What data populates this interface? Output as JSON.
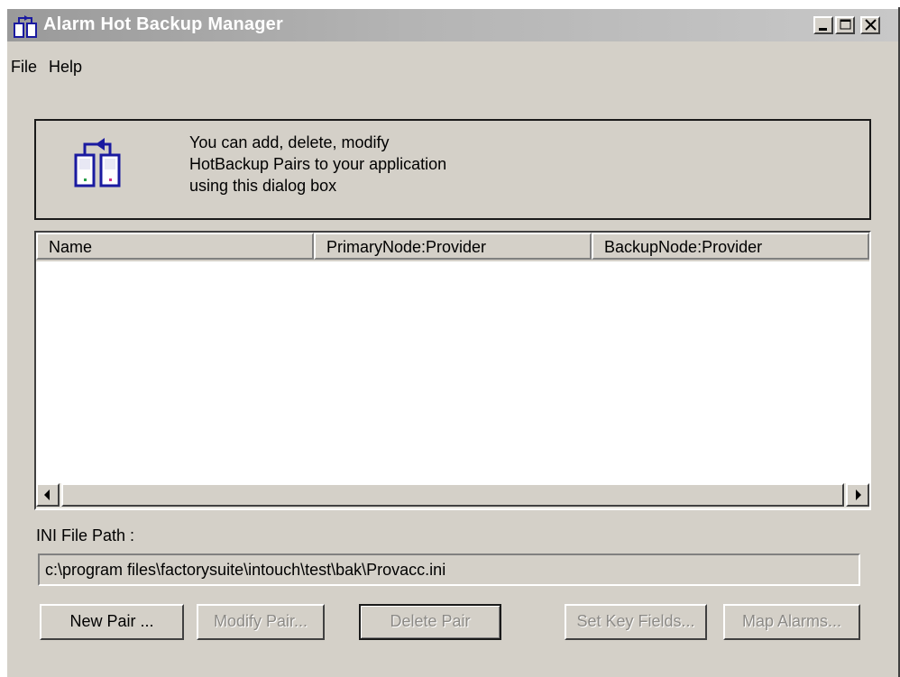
{
  "window": {
    "title": "Alarm Hot Backup Manager",
    "controls": [
      "minimize",
      "maximize",
      "close"
    ]
  },
  "menu": {
    "items": [
      {
        "label": "File"
      },
      {
        "label": "Help"
      }
    ]
  },
  "banner": {
    "icon": "hot-backup-pair-icon",
    "lines": [
      "You can add, delete, modify",
      "HotBackup Pairs to your application",
      "using this dialog box"
    ]
  },
  "list": {
    "columns": [
      "Name",
      "PrimaryNode:Provider",
      "BackupNode:Provider"
    ],
    "rows": []
  },
  "ini": {
    "label": "INI File Path :",
    "value": "c:\\program files\\factorysuite\\intouch\\test\\bak\\Provacc.ini"
  },
  "buttons": {
    "new_pair": "New Pair ...",
    "modify_pair": "Modify Pair...",
    "delete_pair": "Delete Pair",
    "set_key_fields": "Set Key Fields...",
    "map_alarms": "Map Alarms..."
  },
  "colors": {
    "face": "#d4d0c8",
    "icon_blue": "#1a1aa0"
  }
}
